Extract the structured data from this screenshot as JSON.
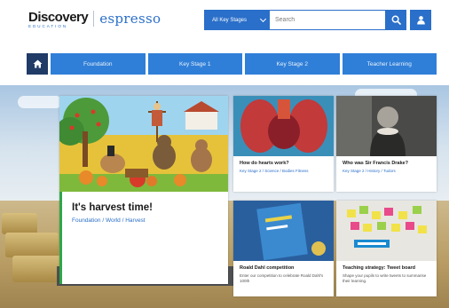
{
  "brand": {
    "name": "Discovery",
    "sub": "EDUCATION",
    "product": "espresso"
  },
  "search": {
    "key_stage_label": "All Key Stages",
    "placeholder": "Search"
  },
  "nav": {
    "items": [
      {
        "label": "Foundation"
      },
      {
        "label": "Key Stage 1"
      },
      {
        "label": "Key Stage 2"
      },
      {
        "label": "Teacher Learning"
      }
    ]
  },
  "cards": {
    "hero": {
      "title": "It's harvest time!",
      "sub": "Foundation / World / Harvest"
    },
    "c2": {
      "title": "How do hearts work?",
      "sub": "Key Stage 2 / Science / Bodies Fitness"
    },
    "c3": {
      "title": "Who was Sir Francis Drake?",
      "sub": "Key Stage 2 / History / Tudors"
    },
    "c4": {
      "title": "Roald Dahl competition",
      "desc": "Enter our competition to celebrate Roald Dahl's 100th"
    },
    "c5": {
      "title": "Teaching strategy: Tweet board",
      "desc": "Shape your pupils to write tweets to summarise their learning."
    }
  },
  "colors": {
    "primary": "#2a6fc9",
    "nav": "#2f7fd8",
    "home": "#1f3b66",
    "accent_green": "#2ea64a"
  }
}
